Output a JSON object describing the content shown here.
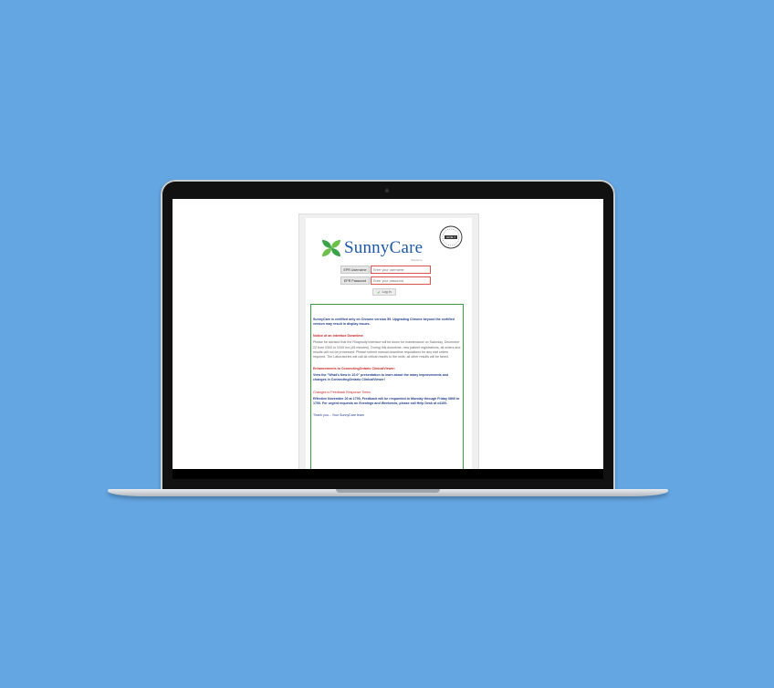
{
  "app": {
    "brand_name": "SunnyCare",
    "brand_sub": "Solutions",
    "badge_text": "LEVEL 2"
  },
  "login": {
    "username_label": "EPR Username",
    "username_placeholder": "Enter your username",
    "password_label": "EPR Password",
    "password_placeholder": "Enter your password",
    "login_button": "Log In"
  },
  "notices": {
    "chrome_notice": "SunnyCare is certified only on Chrome version 59. Upgrading Chrome beyond the certified version may result in display issues.",
    "downtime_heading": "Notice of an Interface Downtime",
    "downtime_body": "Please be advised that the Rhapsody interface will be down for maintenance on Saturday, December 22 from 0300 to 0345 hrs (45 minutes). During this downtime, new patient registrations, all orders and results will not be processed. Please submit manual downtime requisitions for any stat orders required. The Laboratories will call all critical results to the units, all other results will be faxed.",
    "enhancements_heading": "Enhancements to ConnectingOntario ClinicalViewer:",
    "enhancements_body": "View the \"What's New in 10.0\" presentation to learn about the many improvements and changes in ConnectingOntario ClinicalViewer!",
    "feedback_heading": "Changes to Feedback Response Times",
    "feedback_body": "Effective November 20 at 1700, Feedback will be responded to Monday through Friday 0800 to 1700. For urgent requests on Evenings and Weekends, please call Help Desk at x4100.",
    "thanks": "Thank you... Your SunnyCare team"
  },
  "colors": {
    "background": "#64a6e2",
    "brand_blue": "#1f5aa8",
    "notice_border": "#3e9a3e",
    "heading_red": "#c62828",
    "text_navy": "#1f3d8a"
  }
}
